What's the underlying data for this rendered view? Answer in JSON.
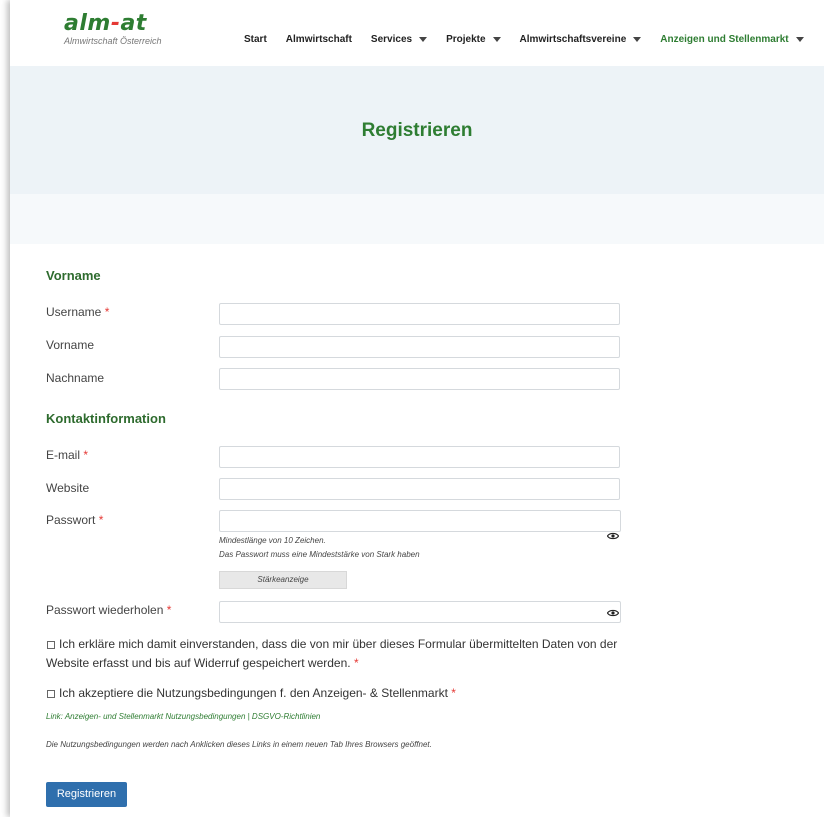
{
  "logo": {
    "name_part1": "alm",
    "name_dash": "-",
    "name_part2": "at",
    "subtitle": "Almwirtschaft Österreich"
  },
  "nav": {
    "items": [
      {
        "label": "Start",
        "has_dropdown": false
      },
      {
        "label": "Almwirtschaft",
        "has_dropdown": false
      },
      {
        "label": "Services",
        "has_dropdown": true
      },
      {
        "label": "Projekte",
        "has_dropdown": true
      },
      {
        "label": "Almwirtschaftsvereine",
        "has_dropdown": true
      },
      {
        "label": "Anzeigen und Stellenmarkt",
        "has_dropdown": true,
        "active": true
      }
    ]
  },
  "hero": {
    "title": "Registrieren"
  },
  "form": {
    "section_name": "Vorname",
    "username_label": "Username",
    "firstname_label": "Vorname",
    "lastname_label": "Nachname",
    "section_contact": "Kontaktinformation",
    "email_label": "E-mail",
    "website_label": "Website",
    "password_label": "Passwort",
    "password_hint1": "Mindestlänge von 10 Zeichen.",
    "password_hint2": "Das Passwort muss eine Mindeststärke von Stark haben",
    "strength_label": "Stärkeanzeige",
    "password_repeat_label": "Passwort wiederholen",
    "required_mark": "*",
    "consent_line1": "Ich erkläre mich damit einverstanden, dass die von mir über dieses Formular übermittelten Daten von der",
    "consent_line2": "Website erfasst und bis auf Widerruf gespeichert werden.",
    "terms_label": "Ich akzeptiere die Nutzungsbedingungen f. den Anzeigen- & Stellenmarkt",
    "terms_link": "Link: Anzeigen- und Stellenmarkt Nutzungsbedingungen | DSGVO-Richtlinien",
    "terms_note": "Die Nutzungsbedingungen werden nach Anklicken dieses Links in einem neuen Tab Ihres Browsers geöffnet.",
    "submit_label": "Registrieren",
    "values": {
      "username": "",
      "firstname": "",
      "lastname": "",
      "email": "",
      "website": "",
      "password": "",
      "password_repeat": ""
    }
  },
  "colors": {
    "brand_green": "#2e7d32",
    "required_red": "#e53935",
    "button_blue": "#2f6fad",
    "hero_bg": "#edf3f7"
  },
  "icons": {
    "password_toggle": "eye-icon",
    "dropdown": "caret-down-icon"
  }
}
